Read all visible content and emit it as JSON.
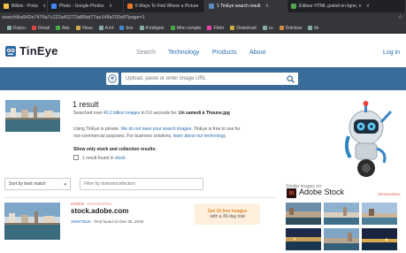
{
  "browser": {
    "tabs": [
      {
        "label": "Billets - Porta",
        "icon_color": "#f3c24b",
        "close": "x"
      },
      {
        "label": "Photo - Google Photos",
        "icon_color": "#4285f4",
        "close": "x"
      },
      {
        "label": "6 Ways To Find Where a Picture",
        "icon_color": "#e5762a",
        "close": "x"
      },
      {
        "label": "1 TinEye search result",
        "icon_color": "#5a8bc0",
        "close": "x"
      },
      {
        "label": "Éditeur HTML gratuit en ligne, n",
        "icon_color": "#4fa84f",
        "close": "x"
      }
    ],
    "address": "search/ba942e7476a7c222a43272a86bd77ae148a702e8?page=1",
    "address_right": "☆",
    "bookmarks": [
      "Knijou",
      "Gmail",
      "Ads",
      "Visus",
      "A int",
      "box",
      "A intégrer",
      "Mon compte",
      "Flickr",
      "Download",
      "cs",
      "Dotclear",
      "lib"
    ]
  },
  "header": {
    "logo": "TinEye",
    "nav": [
      "Search",
      "Technology",
      "Products",
      "About"
    ],
    "login": "Log in"
  },
  "search": {
    "placeholder": "Upload, paste or enter image URL"
  },
  "summary": {
    "count": "1 result",
    "searched_prefix": "Searched over ",
    "searched_count": "40.2 billion images",
    "searched_middle": " in 0.6 seconds for: ",
    "searched_file": "Un samedi à Thoune.jpg",
    "privacy_prefix": "Using TinEye is private. ",
    "privacy_link": "We do not save your search images.",
    "privacy_suffix": " TinEye is free to use for",
    "privacy_line2_prefix": "non-commercial purposes. For business solutions, ",
    "privacy_line2_link": "learn about our technology.",
    "stock_label": "Show only stock and collection results:",
    "stock_count": "1 result found in ",
    "stock_link": "stock."
  },
  "controls": {
    "sort": "Sort by best match",
    "filter_placeholder": "Filter by domain/collection"
  },
  "result": {
    "source": "STOCK",
    "sponsored": "SPONSORED",
    "domain": "stock.adobe.com",
    "id": "306873626",
    "first_found": "First found on Dec 05, 2019",
    "promo_line1": "Get 10 free images",
    "promo_line2": "with a 30-day trial"
  },
  "sidebar": {
    "similar_label": "Similar images on:",
    "brand_mark": "St",
    "brand": "Adobe Stock",
    "sponsored": "SPONSORED"
  },
  "colors": {
    "accent": "#2a6db0",
    "band": "#3a6c99",
    "sponsored": "#d9452e",
    "promo": "#fdf0dc"
  }
}
